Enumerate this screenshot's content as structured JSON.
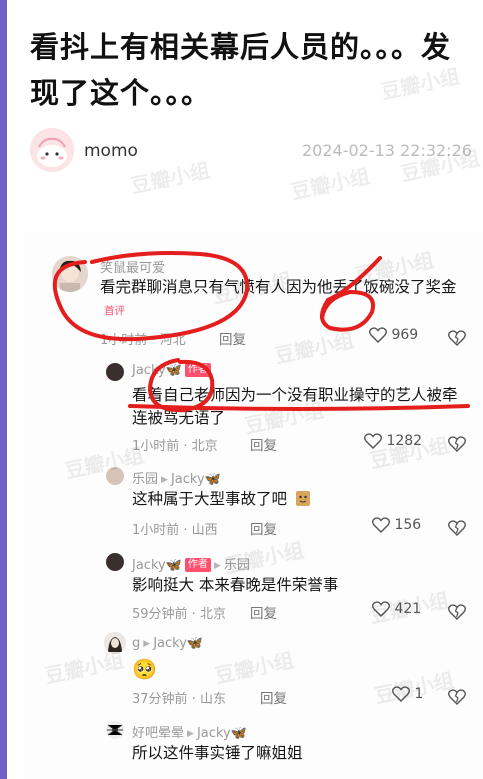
{
  "post": {
    "title": "看抖上有相关幕后人员的。。。发现了这个。。。",
    "author": "momo",
    "date": "2024-02-13 22:32:26"
  },
  "watermark": "豆瓣小组",
  "comments": [
    {
      "name": "笑鼠最可爱",
      "text": "看完群聊消息只有气愤有人因为他丢了饭碗没了奖金",
      "tag": "首评",
      "time": "1小时前 · 河北",
      "reply": "回复",
      "likes": "969"
    },
    {
      "name": "Jacky",
      "tag": "作者",
      "text": "看着自己老师因为一个没有职业操守的艺人被牵连被骂无语了",
      "time": "1小时前 · 北京",
      "reply": "回复",
      "likes": "1282"
    },
    {
      "name": "乐园",
      "reply_to": "Jacky",
      "text": "这种属于大型事故了吧",
      "time": "1小时前 · 山西",
      "reply": "回复",
      "likes": "156"
    },
    {
      "name": "Jacky",
      "tag": "作者",
      "reply_to": "乐园",
      "text": "影响挺大 本来春晚是件荣誉事",
      "time": "59分钟前 · 北京",
      "reply": "回复",
      "likes": "421"
    },
    {
      "name": "g",
      "reply_to": "Jacky",
      "text": "🥺",
      "time": "37分钟前 · 山东",
      "reply": "回复",
      "likes": "1"
    },
    {
      "name": "好吧晕晕",
      "reply_to": "Jacky",
      "text": "所以这件事实锤了嘛姐姐"
    }
  ],
  "colors": {
    "accent_bar": "#6f5fc7",
    "annotation_red": "#e41d1d",
    "author_tag": "#fe4f6f",
    "butterfly": "#3a8ce0"
  }
}
